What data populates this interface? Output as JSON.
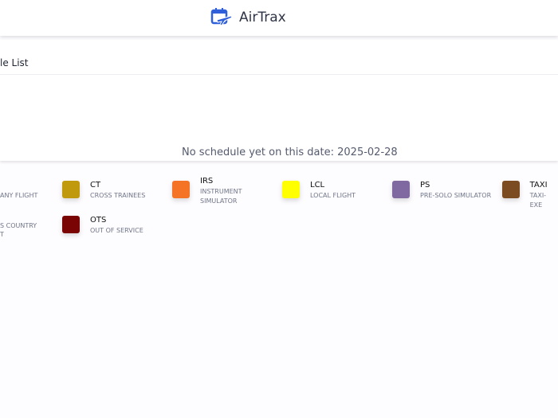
{
  "header": {
    "app_name": "AirTrax",
    "logo_icon": "calendar-plane-icon",
    "brand_color": "#2f5fdb"
  },
  "card": {
    "title_fragment": "le List",
    "empty_message": "No schedule yet on this date: 2025-02-28"
  },
  "legend": {
    "clipped": [
      "ANY FLIGHT",
      "S COUNTRY",
      "T"
    ],
    "items": [
      {
        "code": "CT",
        "desc": "CROSS TRAINEES",
        "color": "#c09a0c"
      },
      {
        "code": "IRS",
        "desc": "INSTRUMENT SIMULATOR",
        "color": "#f47324"
      },
      {
        "code": "LCL",
        "desc": "LOCAL FLIGHT",
        "color": "#ffff00"
      },
      {
        "code": "PS",
        "desc": "PRE-SOLO SIMULATOR",
        "color": "#8068a0"
      },
      {
        "code": "TAXI",
        "desc": "TAXI-EXE",
        "color": "#7b4b22"
      },
      {
        "code": "OTS",
        "desc": "OUT OF SERVICE",
        "color": "#7a0404"
      }
    ]
  }
}
